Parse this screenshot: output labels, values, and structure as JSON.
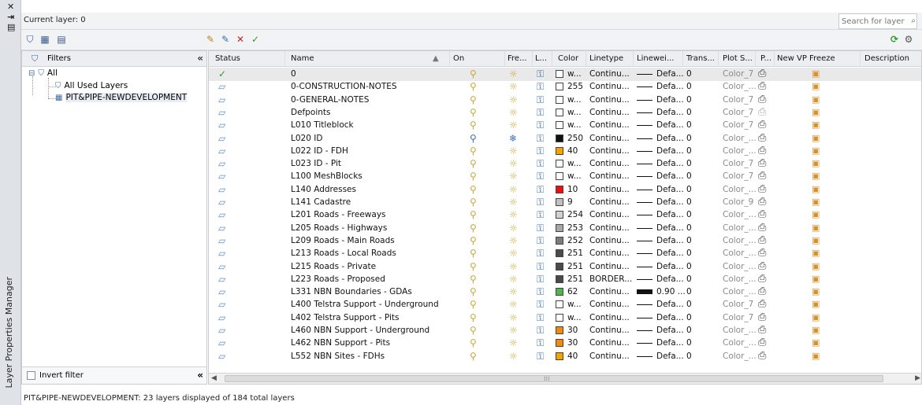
{
  "palette_title": "Layer Properties Manager",
  "current_layer_text": "Current layer: 0",
  "search": {
    "placeholder": "Search for layer"
  },
  "filters": {
    "header": "Filters",
    "tree": [
      {
        "label": "All",
        "level": 0
      },
      {
        "label": "All Used Layers",
        "level": 1
      },
      {
        "label": "PIT&PIPE-NEWDEVELOPMENT",
        "level": 1
      }
    ],
    "invert_filter_label": "Invert filter",
    "invert_filter_checked": false
  },
  "columns": [
    "Status",
    "Name",
    "On",
    "Fre...",
    "L...",
    "Color",
    "Linetype",
    "Linewei...",
    "Trans...",
    "Plot S...",
    "P...",
    "New VP Freeze",
    "Description"
  ],
  "layers": [
    {
      "name": "0",
      "current": true,
      "color_num": "w...",
      "color_hex": "#ffffff",
      "linetype": "Continu...",
      "lineweight": "Defa...",
      "thick": false,
      "trans": "0",
      "plot_style": "Color_7",
      "frozen": false,
      "on_blue": false,
      "plot_on": true
    },
    {
      "name": "0-CONSTRUCTION-NOTES",
      "current": false,
      "color_num": "255",
      "color_hex": "#ffffff",
      "linetype": "Continu...",
      "lineweight": "Defa...",
      "thick": false,
      "trans": "0",
      "plot_style": "Color_...",
      "frozen": false,
      "on_blue": false,
      "plot_on": true
    },
    {
      "name": "0-GENERAL-NOTES",
      "current": false,
      "color_num": "w...",
      "color_hex": "#ffffff",
      "linetype": "Continu...",
      "lineweight": "Defa...",
      "thick": false,
      "trans": "0",
      "plot_style": "Color_7",
      "frozen": false,
      "on_blue": false,
      "plot_on": true
    },
    {
      "name": "Defpoints",
      "current": false,
      "color_num": "w...",
      "color_hex": "#ffffff",
      "linetype": "Continu...",
      "lineweight": "Defa...",
      "thick": false,
      "trans": "0",
      "plot_style": "Color_7",
      "frozen": false,
      "on_blue": false,
      "plot_on": false
    },
    {
      "name": "L010 Titleblock",
      "current": false,
      "color_num": "w...",
      "color_hex": "#ffffff",
      "linetype": "Continu...",
      "lineweight": "Defa...",
      "thick": false,
      "trans": "0",
      "plot_style": "Color_7",
      "frozen": false,
      "on_blue": false,
      "plot_on": true
    },
    {
      "name": "L020 ID",
      "current": false,
      "color_num": "250",
      "color_hex": "#111111",
      "linetype": "Continu...",
      "lineweight": "Defa...",
      "thick": false,
      "trans": "0",
      "plot_style": "Color_...",
      "frozen": true,
      "on_blue": true,
      "plot_on": true
    },
    {
      "name": "L022 ID - FDH",
      "current": false,
      "color_num": "40",
      "color_hex": "#f5a300",
      "linetype": "Continu...",
      "lineweight": "Defa...",
      "thick": false,
      "trans": "0",
      "plot_style": "Color_...",
      "frozen": false,
      "on_blue": false,
      "plot_on": true
    },
    {
      "name": "L023 ID - Pit",
      "current": false,
      "color_num": "w...",
      "color_hex": "#ffffff",
      "linetype": "Continu...",
      "lineweight": "Defa...",
      "thick": false,
      "trans": "0",
      "plot_style": "Color_7",
      "frozen": false,
      "on_blue": false,
      "plot_on": true
    },
    {
      "name": "L100 MeshBlocks",
      "current": false,
      "color_num": "w...",
      "color_hex": "#ffffff",
      "linetype": "Continu...",
      "lineweight": "Defa...",
      "thick": false,
      "trans": "0",
      "plot_style": "Color_7",
      "frozen": false,
      "on_blue": false,
      "plot_on": true
    },
    {
      "name": "L140 Addresses",
      "current": false,
      "color_num": "10",
      "color_hex": "#e81010",
      "linetype": "Continu...",
      "lineweight": "Defa...",
      "thick": false,
      "trans": "0",
      "plot_style": "Color_...",
      "frozen": false,
      "on_blue": false,
      "plot_on": true
    },
    {
      "name": "L141 Cadastre",
      "current": false,
      "color_num": "9",
      "color_hex": "#c0c0c0",
      "linetype": "Continu...",
      "lineweight": "Defa...",
      "thick": false,
      "trans": "0",
      "plot_style": "Color_9",
      "frozen": false,
      "on_blue": false,
      "plot_on": true
    },
    {
      "name": "L201 Roads - Freeways",
      "current": false,
      "color_num": "254",
      "color_hex": "#d2d2d2",
      "linetype": "Continu...",
      "lineweight": "Defa...",
      "thick": false,
      "trans": "0",
      "plot_style": "Color_...",
      "frozen": false,
      "on_blue": false,
      "plot_on": true
    },
    {
      "name": "L205 Roads - Highways",
      "current": false,
      "color_num": "253",
      "color_hex": "#a8a8a8",
      "linetype": "Continu...",
      "lineweight": "Defa...",
      "thick": false,
      "trans": "0",
      "plot_style": "Color_...",
      "frozen": false,
      "on_blue": false,
      "plot_on": true
    },
    {
      "name": "L209 Roads - Main Roads",
      "current": false,
      "color_num": "252",
      "color_hex": "#7c7c7c",
      "linetype": "Continu...",
      "lineweight": "Defa...",
      "thick": false,
      "trans": "0",
      "plot_style": "Color_...",
      "frozen": false,
      "on_blue": false,
      "plot_on": true
    },
    {
      "name": "L213 Roads - Local Roads",
      "current": false,
      "color_num": "251",
      "color_hex": "#4a4a4a",
      "linetype": "Continu...",
      "lineweight": "Defa...",
      "thick": false,
      "trans": "0",
      "plot_style": "Color_...",
      "frozen": false,
      "on_blue": false,
      "plot_on": true
    },
    {
      "name": "L215 Roads - Private",
      "current": false,
      "color_num": "251",
      "color_hex": "#4a4a4a",
      "linetype": "Continu...",
      "lineweight": "Defa...",
      "thick": false,
      "trans": "0",
      "plot_style": "Color_...",
      "frozen": false,
      "on_blue": false,
      "plot_on": true
    },
    {
      "name": "L223 Roads - Proposed",
      "current": false,
      "color_num": "251",
      "color_hex": "#4a4a4a",
      "linetype": "BORDER...",
      "lineweight": "Defa...",
      "thick": false,
      "trans": "0",
      "plot_style": "Color_...",
      "frozen": false,
      "on_blue": false,
      "plot_on": true
    },
    {
      "name": "L331 NBN Boundaries - GDAs",
      "current": false,
      "color_num": "62",
      "color_hex": "#4cb84c",
      "linetype": "Continu...",
      "lineweight": "0.90 ...",
      "thick": true,
      "trans": "0",
      "plot_style": "Color_...",
      "frozen": false,
      "on_blue": false,
      "plot_on": true
    },
    {
      "name": "L400 Telstra Support - Underground",
      "current": false,
      "color_num": "w...",
      "color_hex": "#ffffff",
      "linetype": "Continu...",
      "lineweight": "Defa...",
      "thick": false,
      "trans": "0",
      "plot_style": "Color_7",
      "frozen": false,
      "on_blue": false,
      "plot_on": true
    },
    {
      "name": "L402 Telstra Support - Pits",
      "current": false,
      "color_num": "w...",
      "color_hex": "#ffffff",
      "linetype": "Continu...",
      "lineweight": "Defa...",
      "thick": false,
      "trans": "0",
      "plot_style": "Color_7",
      "frozen": false,
      "on_blue": false,
      "plot_on": true
    },
    {
      "name": "L460 NBN Support - Underground",
      "current": false,
      "color_num": "30",
      "color_hex": "#f08a10",
      "linetype": "Continu...",
      "lineweight": "Defa...",
      "thick": false,
      "trans": "0",
      "plot_style": "Color_...",
      "frozen": false,
      "on_blue": false,
      "plot_on": true
    },
    {
      "name": "L462 NBN Support - Pits",
      "current": false,
      "color_num": "30",
      "color_hex": "#f08a10",
      "linetype": "Continu...",
      "lineweight": "Defa...",
      "thick": false,
      "trans": "0",
      "plot_style": "Color_...",
      "frozen": false,
      "on_blue": false,
      "plot_on": true
    },
    {
      "name": "L552 NBN Sites - FDHs",
      "current": false,
      "color_num": "40",
      "color_hex": "#f5a300",
      "linetype": "Continu...",
      "lineweight": "Defa...",
      "thick": false,
      "trans": "0",
      "plot_style": "Color_...",
      "frozen": false,
      "on_blue": false,
      "plot_on": true
    }
  ],
  "status_text": "PIT&PIPE-NEWDEVELOPMENT: 23 layers displayed of 184 total layers",
  "icons": {
    "current_status": "✓",
    "layer_status": "▱",
    "on": "💡",
    "thawed": "☼",
    "frozen": "❄",
    "unlocked": "🔓",
    "plot": "⎙",
    "vp_freeze": "▣"
  }
}
